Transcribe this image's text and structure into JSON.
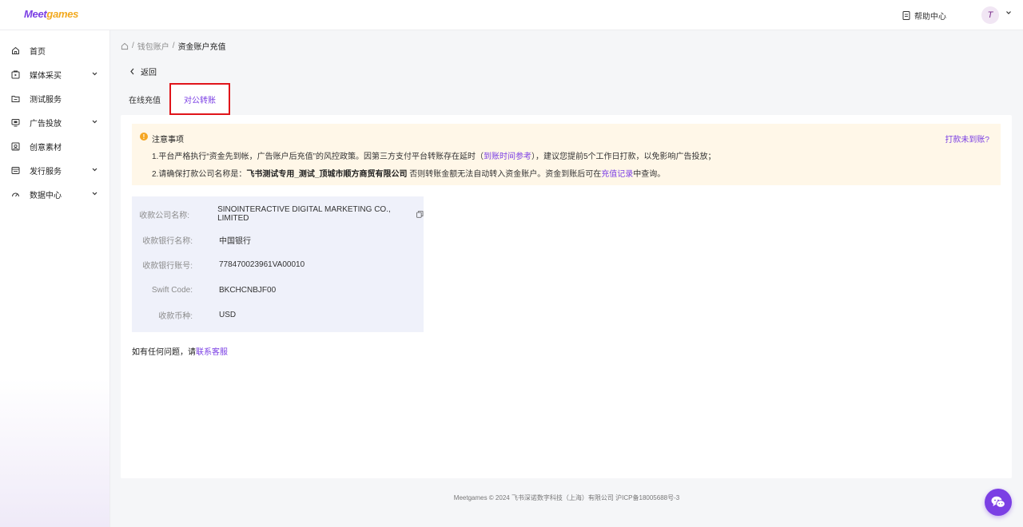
{
  "app": {
    "logo_main": "Meet",
    "logo_accent": "games"
  },
  "header": {
    "help_label": "帮助中心",
    "avatar_initial": "T"
  },
  "sidebar": {
    "items": [
      {
        "label": "首页",
        "icon": "home-icon",
        "expandable": false
      },
      {
        "label": "媒体采买",
        "icon": "media-icon",
        "expandable": true
      },
      {
        "label": "测试服务",
        "icon": "folder-icon",
        "expandable": false
      },
      {
        "label": "广告投放",
        "icon": "monitor-icon",
        "expandable": true
      },
      {
        "label": "创意素材",
        "icon": "image-icon",
        "expandable": false
      },
      {
        "label": "发行服务",
        "icon": "publish-icon",
        "expandable": true
      },
      {
        "label": "数据中心",
        "icon": "dashboard-icon",
        "expandable": true
      }
    ]
  },
  "breadcrumb": {
    "items": [
      "钱包账户",
      "资金账户充值"
    ]
  },
  "back_label": "返回",
  "tabs": {
    "online": "在线充值",
    "transfer": "对公转账"
  },
  "notice": {
    "title": "注意事项",
    "link": "打款未到账?",
    "line1_prefix": "1.平台严格执行“资金先到帐，广告账户后充值”的风控政策。因第三方支付平台转账存在延时（",
    "line1_link": "到账时间参考",
    "line1_suffix": "），建议您提前5个工作日打款，以免影响广告投放；",
    "line2_prefix": "2.请确保打款公司名称是：",
    "line2_company": "飞书测试专用_测试_顶城市顺方商贸有限公司",
    "line2_mid": " 否则转账金额无法自动转入资金账户。资金到账后可在",
    "line2_link": "充值记录",
    "line2_suffix": "中查询。"
  },
  "bank_info": {
    "rows": [
      {
        "label": "收款公司名称:",
        "value": "SINOINTERACTIVE DIGITAL MARKETING CO., LIMITED"
      },
      {
        "label": "收款银行名称:",
        "value": "中国银行"
      },
      {
        "label": "收款银行账号:",
        "value": "778470023961VA00010"
      },
      {
        "label": "Swift Code:",
        "value": "BKCHCNBJF00"
      },
      {
        "label": "收款币种:",
        "value": "USD"
      }
    ]
  },
  "contact": {
    "prefix": "如有任何问题，请",
    "link": "联系客服"
  },
  "footer": "Meetgames © 2024 飞书深诺数字科技（上海）有限公司 沪ICP备18005688号-3",
  "colors": {
    "brand": "#7b3fe4",
    "accent": "#f2a91f",
    "notice_bg": "#fff7e8",
    "info_bg": "#eff1fa",
    "highlight_border": "#e0141a"
  }
}
